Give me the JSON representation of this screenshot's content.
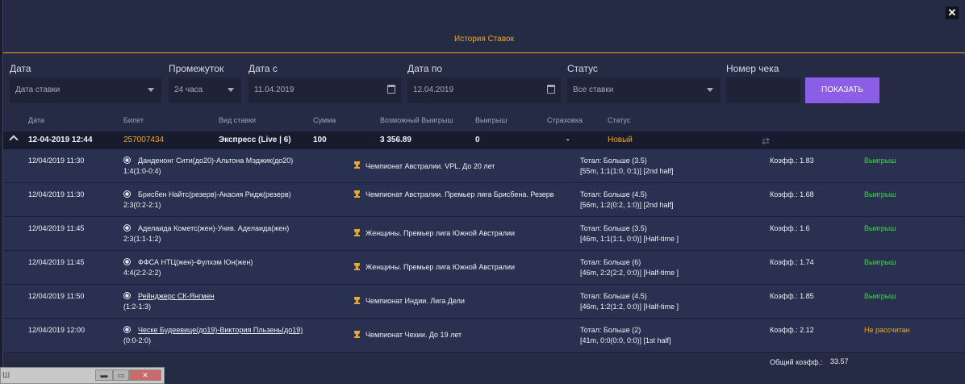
{
  "window": {
    "title": "История Ставок",
    "close_label": "✕"
  },
  "filters": {
    "date_label": "Дата",
    "date_value": "Дата ставки",
    "period_label": "Промежуток",
    "period_value": "24 часа",
    "from_label": "Дата с",
    "from_value": "11.04.2019",
    "to_label": "Дата по",
    "to_value": "12.04.2019",
    "status_label": "Статус",
    "status_value": "Все ставки",
    "receipt_label": "Номер чека",
    "receipt_value": "",
    "show_button": "ПОКАЗАТЬ"
  },
  "table_header": {
    "date": "Дата",
    "ticket": "Билет",
    "bet_type": "Вид ставки",
    "amount": "Сумма",
    "possible_win": "Возможный Выигрыш",
    "win": "Выигрыш",
    "insurance": "Страховка",
    "status": "Статус"
  },
  "ticket": {
    "date": "12-04-2019 12:44",
    "number": "257007434",
    "bet_type": "Экспресс (Live | 6)",
    "amount": "100",
    "possible_win": "3 356.89",
    "win": "0",
    "insurance": "-",
    "status": "Новый"
  },
  "events": [
    {
      "time": "12/04/2019 11:30",
      "match": "Данденонг Сити(до20)-Альтона Мэджик(до20)",
      "score": "1:4(1:0-0:4)",
      "league": "Чемпионат Австралии. VPL. До 20 лет",
      "total_line": "Тотал:   Больше (3.5)",
      "total_info": "[55m, 1:1(1:0, 0:1)] [2nd half]",
      "coef": "Коэфф.:  1.83",
      "status": "Выигрыш",
      "status_type": "win"
    },
    {
      "time": "12/04/2019 11:30",
      "match": "Брисбен Найтс(резерв)-Акасия Ридж(резерв)",
      "score": "2:3(0:2-2:1)",
      "league": "Чемпионат Австралии. Премьер лига Брисбена. Резерв",
      "total_line": "Тотал:   Больше (4.5)",
      "total_info": "[56m, 1:2(0:2, 1:0)] [2nd half]",
      "coef": "Коэфф.:  1.68",
      "status": "Выигрыш",
      "status_type": "win"
    },
    {
      "time": "12/04/2019 11:45",
      "match": "Аделаида Кометс(жен)-Унив. Аделаида(жен)",
      "score": "2:3(1:1-1:2)",
      "league": "Женщины. Премьер лига Южной Австралии",
      "total_line": "Тотал:   Больше (3.5)",
      "total_info": "[46m, 1:1(1:1, 0:0)] [Half-time ]",
      "coef": "Коэфф.:  1.6",
      "status": "Выигрыш",
      "status_type": "win"
    },
    {
      "time": "12/04/2019 11:45",
      "match": "ФФСА НТЦ(жен)-Фулхэм Юн(жен)",
      "score": "4:4(2:2-2:2)",
      "league": "Женщины. Премьер лига Южной Австралии",
      "total_line": "Тотал:   Больше (6)",
      "total_info": "[46m, 2:2(2:2, 0:0)] [Half-time ]",
      "coef": "Коэфф.:  1.74",
      "status": "Выигрыш",
      "status_type": "win"
    },
    {
      "time": "12/04/2019 11:50",
      "match": "Рейнджерс СК-Янгмен",
      "score": "(1:2-1:3)",
      "league": "Чемпионат Индии. Лига Дели",
      "total_line": "Тотал:   Больше (4.5)",
      "total_info": "[46m, 1:2(1:2, 0:0)] [Half-time ]",
      "coef": "Коэфф.:  1.85",
      "status": "Выигрыш",
      "status_type": "win"
    },
    {
      "time": "12/04/2019 12:00",
      "match": "Ческе Будеевице(до19)-Виктория Пльзень(до19)",
      "score": "(0:0-2:0)",
      "league": "Чемпионат Чехии. До 19 лет",
      "total_line": "Тотал:   Больше (2)",
      "total_info": "[41m, 0:0(0:0, 0:0)] [1st half]",
      "coef": "Коэфф.:  2.12",
      "status": "Не рассчитан",
      "status_type": "unset"
    }
  ],
  "footer": {
    "total_coef_label": "Общий коэфф.:",
    "total_coef_value": "33.57"
  },
  "taskbar": {
    "label": "Ш",
    "minimize": "▬",
    "maximize": "▭",
    "close": "✕"
  },
  "colors": {
    "accent": "#f0a81c",
    "button": "#8c5de6",
    "win": "#3fd34a",
    "background": "#252b44"
  }
}
